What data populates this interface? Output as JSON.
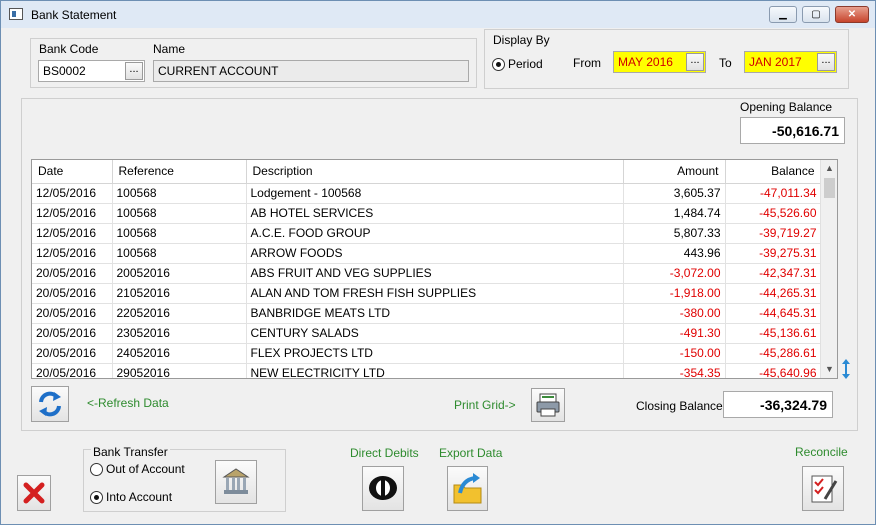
{
  "window": {
    "title": "Bank Statement"
  },
  "bank": {
    "code_label": "Bank Code",
    "code_value": "BS0002",
    "name_label": "Name",
    "name_value": "CURRENT ACCOUNT",
    "browse_label": "..."
  },
  "display_by": {
    "label": "Display By",
    "period_label": "Period",
    "from_label": "From",
    "from_value": "MAY 2016",
    "to_label": "To",
    "to_value": "JAN 2017"
  },
  "opening_balance": {
    "label": "Opening Balance",
    "value": "-50,616.71"
  },
  "grid": {
    "columns": [
      "Date",
      "Reference",
      "Description",
      "Amount",
      "Balance"
    ],
    "rows": [
      {
        "date": "12/05/2016",
        "ref": "100568",
        "desc": "Lodgement - 100568",
        "amount": "3,605.37",
        "balance": "-47,011.34"
      },
      {
        "date": "12/05/2016",
        "ref": "100568",
        "desc": "AB HOTEL SERVICES",
        "amount": "1,484.74",
        "balance": "-45,526.60"
      },
      {
        "date": "12/05/2016",
        "ref": "100568",
        "desc": "A.C.E. FOOD GROUP",
        "amount": "5,807.33",
        "balance": "-39,719.27"
      },
      {
        "date": "12/05/2016",
        "ref": "100568",
        "desc": "ARROW FOODS",
        "amount": "443.96",
        "balance": "-39,275.31"
      },
      {
        "date": "20/05/2016",
        "ref": "20052016",
        "desc": "ABS  FRUIT AND VEG SUPPLIES",
        "amount": "-3,072.00",
        "balance": "-42,347.31"
      },
      {
        "date": "20/05/2016",
        "ref": "21052016",
        "desc": "ALAN AND TOM FRESH FISH SUPPLIES",
        "amount": "-1,918.00",
        "balance": "-44,265.31"
      },
      {
        "date": "20/05/2016",
        "ref": "22052016",
        "desc": "BANBRIDGE MEATS LTD",
        "amount": "-380.00",
        "balance": "-44,645.31"
      },
      {
        "date": "20/05/2016",
        "ref": "23052016",
        "desc": "CENTURY SALADS",
        "amount": "-491.30",
        "balance": "-45,136.61"
      },
      {
        "date": "20/05/2016",
        "ref": "24052016",
        "desc": "FLEX PROJECTS LTD",
        "amount": "-150.00",
        "balance": "-45,286.61"
      },
      {
        "date": "20/05/2016",
        "ref": "29052016",
        "desc": "NEW ELECTRICITY LTD",
        "amount": "-354.35",
        "balance": "-45,640.96"
      }
    ]
  },
  "actions": {
    "refresh_label": "<-Refresh Data",
    "print_label": "Print Grid->",
    "closing_label": "Closing Balance",
    "closing_value": "-36,324.79",
    "bank_transfer_label": "Bank Transfer",
    "out_of_account_label": "Out of Account",
    "into_account_label": "Into Account",
    "direct_debits_label": "Direct Debits",
    "export_label": "Export Data",
    "reconcile_label": "Reconcile"
  },
  "colors": {
    "negative": "#e00000",
    "highlight_field": "#ffff00",
    "green_label": "#2e8b2e"
  }
}
